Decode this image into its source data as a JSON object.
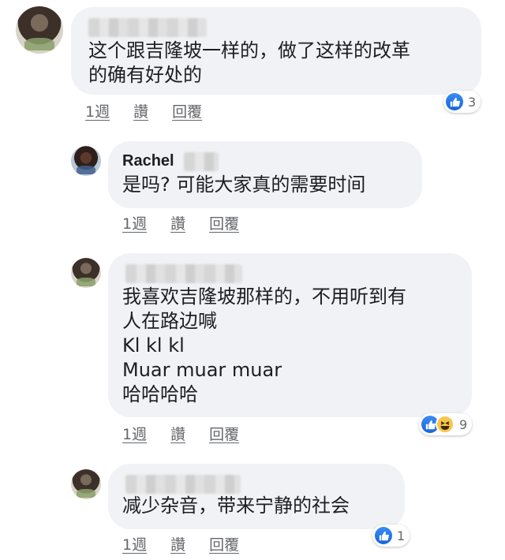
{
  "comments": [
    {
      "name": "",
      "text": "这个跟吉隆坡一样的，做了这样的改革\n的确有好处的",
      "time": "1週",
      "like_label": "讚",
      "reply_label": "回覆",
      "reaction_count": "3"
    },
    {
      "name": "Rachel",
      "text": "是吗? 可能大家真的需要时间",
      "time": "1週",
      "like_label": "讚",
      "reply_label": "回覆",
      "reaction_count": ""
    },
    {
      "name": "",
      "text": "我喜欢吉隆坡那样的，不用听到有\n人在路边喊\nKl kl kl\nMuar muar muar\n哈哈哈哈",
      "time": "1週",
      "like_label": "讚",
      "reply_label": "回覆",
      "reaction_count": "9"
    },
    {
      "name": "",
      "text": "减少杂音，带来宁静的社会",
      "time": "1週",
      "like_label": "讚",
      "reply_label": "回覆",
      "reaction_count": "1"
    }
  ],
  "colors": {
    "bubble": "#f0f2f5",
    "like_blue": "#1877f2",
    "meta_grey": "#65676b"
  },
  "icons": [
    "like-reaction-icon",
    "haha-reaction-icon"
  ]
}
